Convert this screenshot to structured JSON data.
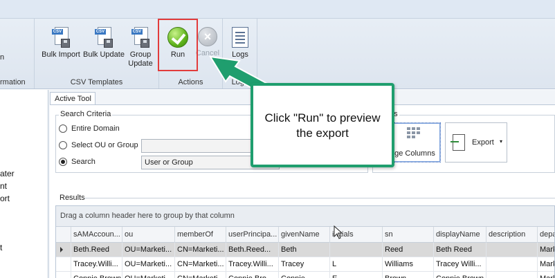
{
  "ribbon": {
    "partial_left_top": "n",
    "partial_left_group": "rmation",
    "buttons": {
      "bulk_import": "Bulk Import",
      "bulk_update": "Bulk Update",
      "group_update_line1": "Group",
      "group_update_line2": "Update",
      "run": "Run",
      "cancel": "Cancel",
      "logs": "Logs"
    },
    "groups": {
      "csv_templates": "CSV Templates",
      "actions": "Actions",
      "logs_group": "Logs"
    }
  },
  "sidebar": {
    "items": [
      "ater",
      "nt",
      "ort",
      "t"
    ]
  },
  "tool": {
    "tab_label": "Active Tool",
    "search_criteria": {
      "label": "Search Criteria",
      "entire_domain": "Entire Domain",
      "select_ou": "Select OU or Group",
      "search": "Search",
      "search_value": "User or Group"
    },
    "options": {
      "label": "ns",
      "change_columns": "nge Columns",
      "export": "Export"
    },
    "results": {
      "label": "Results",
      "group_hint": "Drag a column header here to group by that column",
      "columns": [
        "sAMAccoun...",
        "ou",
        "memberOf",
        "userPrincipa...",
        "givenName",
        "initials",
        "sn",
        "displayName",
        "description",
        "depa"
      ],
      "rows": [
        [
          "Beth.Reed",
          "OU=Marketi...",
          "CN=Marketi...",
          "Beth.Reed...",
          "Beth",
          "",
          "Reed",
          "Beth Reed",
          "",
          "Mark"
        ],
        [
          "Tracey.Willi...",
          "OU=Marketi...",
          "CN=Marketi...",
          "Tracey.Willi...",
          "Tracey",
          "L",
          "Williams",
          "Tracey Willi...",
          "",
          "Mark"
        ],
        [
          "Connie.Brown",
          "OU=Marketi...",
          "CN=Marketi...",
          "Connie.Bro...",
          "Connie",
          "E",
          "Brown",
          "Connie Brown",
          "",
          "Mark"
        ]
      ]
    }
  },
  "callout": {
    "line1": "Click \"Run\" to preview",
    "line2": "the export"
  },
  "colors": {
    "callout_border": "#1f9e6e",
    "highlight": "#e23b3b"
  }
}
